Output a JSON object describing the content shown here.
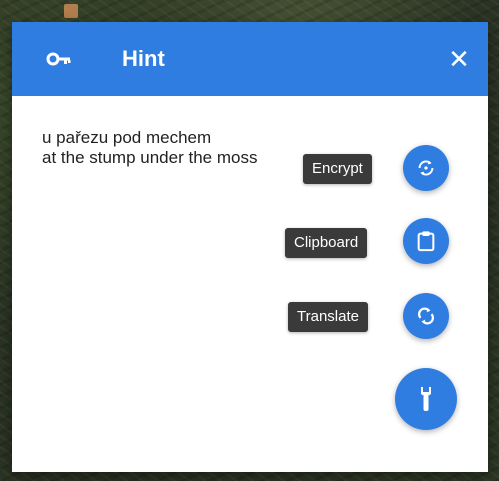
{
  "dialog": {
    "title": "Hint",
    "hint_lines": [
      "u pařezu pod mechem",
      "at the stump under the moss"
    ]
  },
  "actions": [
    {
      "label": "Encrypt",
      "icon": "encrypt-icon"
    },
    {
      "label": "Clipboard",
      "icon": "clipboard-icon"
    },
    {
      "label": "Translate",
      "icon": "translate-icon"
    }
  ],
  "main_action": {
    "icon": "wrench-icon"
  },
  "colors": {
    "accent": "#2f7de1",
    "chip": "#3a3a3a"
  }
}
